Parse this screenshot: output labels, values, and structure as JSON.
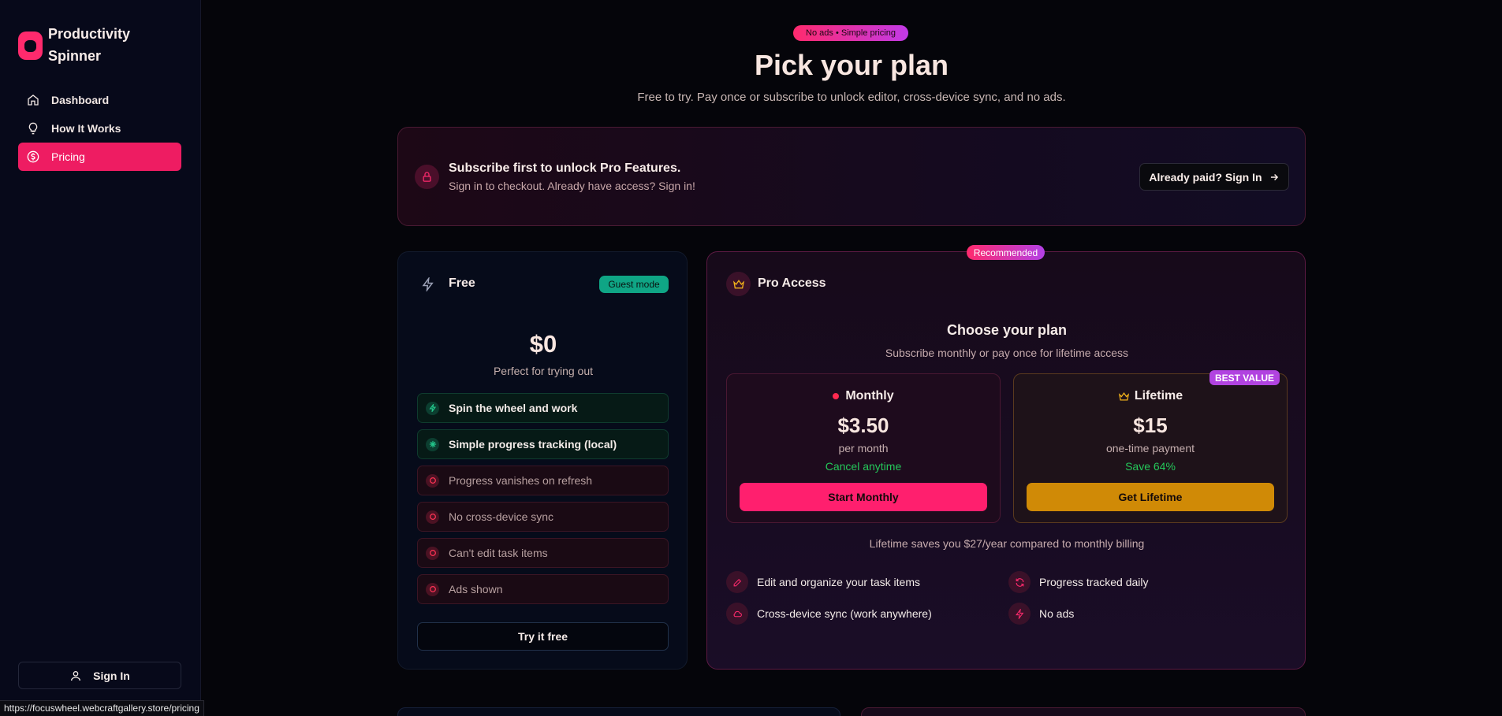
{
  "brand": {
    "name": "Productivity Spinner",
    "logo_color": "#ff2a6d"
  },
  "sidebar": {
    "items": [
      {
        "label": "Dashboard",
        "icon": "home-icon",
        "active": false
      },
      {
        "label": "How It Works",
        "icon": "lightbulb-icon",
        "active": false
      },
      {
        "label": "Pricing",
        "icon": "dollar-circle-icon",
        "active": true
      }
    ],
    "sign_in": "Sign In"
  },
  "status_url": "https://focuswheel.webcraftgallery.store/pricing",
  "header": {
    "badge": "No ads • Simple pricing",
    "title": "Pick your plan",
    "subtitle": "Free to try. Pay once or subscribe to unlock editor, cross-device sync, and no ads."
  },
  "notice": {
    "title": "Subscribe first to unlock Pro Features.",
    "text": "Sign in to checkout. Already have access? Sign in!",
    "button": "Already paid? Sign In"
  },
  "free_plan": {
    "title": "Free",
    "badge": "Guest mode",
    "price": "$0",
    "note": "Perfect for trying out",
    "features": [
      {
        "label": "Spin the wheel and work",
        "included": true
      },
      {
        "label": "Simple progress tracking (local)",
        "included": true
      },
      {
        "label": "Progress vanishes on refresh",
        "included": false
      },
      {
        "label": "No cross-device sync",
        "included": false
      },
      {
        "label": "Can't edit task items",
        "included": false
      },
      {
        "label": "Ads shown",
        "included": false
      }
    ],
    "button": "Try it free"
  },
  "pro_plan": {
    "recommended": "Recommended",
    "title": "Pro Access",
    "choose_title": "Choose your plan",
    "choose_sub": "Subscribe monthly or pay once for lifetime access",
    "monthly": {
      "name": "Monthly",
      "price": "$3.50",
      "term": "per month",
      "highlight": "Cancel anytime",
      "button": "Start Monthly"
    },
    "lifetime": {
      "badge": "BEST VALUE",
      "name": "Lifetime",
      "price": "$15",
      "term": "one-time payment",
      "highlight": "Save 64%",
      "button": "Get Lifetime"
    },
    "savings_line": "Lifetime saves you $27/year compared to monthly billing",
    "perks": [
      {
        "label": "Edit and organize your task items",
        "icon": "pencil-icon"
      },
      {
        "label": "Progress tracked daily",
        "icon": "refresh-icon"
      },
      {
        "label": "Cross-device sync (work anywhere)",
        "icon": "cloud-icon"
      },
      {
        "label": "No ads",
        "icon": "bolt-icon"
      }
    ]
  },
  "colors": {
    "accent": "#ff1f6e",
    "gold": "#d08a06",
    "success": "#24c75a",
    "purple": "#b143e0"
  }
}
